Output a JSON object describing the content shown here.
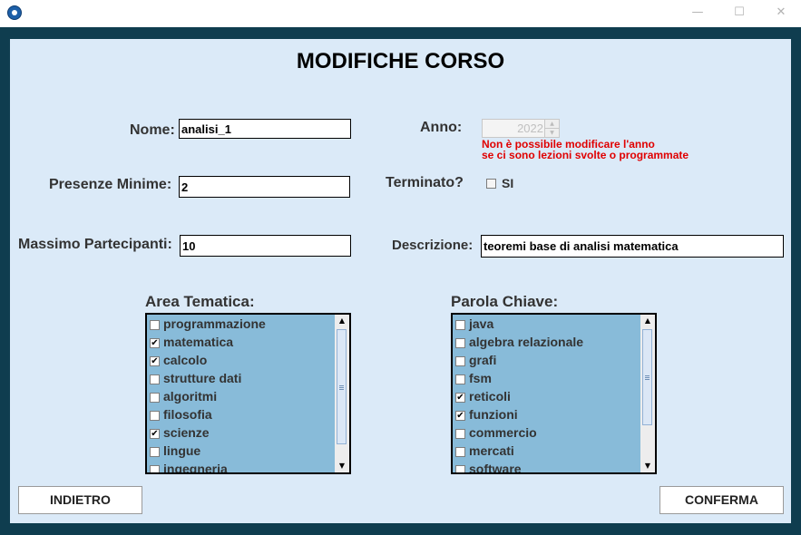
{
  "window": {
    "minimize_glyph": "—",
    "maximize_glyph": "☐",
    "close_glyph": "✕"
  },
  "heading": "MODIFICHE CORSO",
  "form": {
    "nome_label": "Nome:",
    "nome_value": "analisi_1",
    "presenze_label": "Presenze Minime:",
    "presenze_value": "2",
    "massimo_label": "Massimo Partecipanti:",
    "massimo_value": "10",
    "anno_label": "Anno:",
    "anno_value": "2022",
    "anno_warning_line1": "Non è possibile modificare l'anno",
    "anno_warning_line2": "se ci sono lezioni svolte o programmate",
    "terminato_label": "Terminato?",
    "terminato_option": "SI",
    "terminato_checked": false,
    "descrizione_label": "Descrizione:",
    "descrizione_value": "teoremi base di analisi matematica"
  },
  "area_tematica": {
    "title": "Area Tematica:",
    "items": [
      {
        "label": "programmazione",
        "checked": false
      },
      {
        "label": "matematica",
        "checked": true
      },
      {
        "label": "calcolo",
        "checked": true
      },
      {
        "label": "strutture dati",
        "checked": false
      },
      {
        "label": "algoritmi",
        "checked": false
      },
      {
        "label": "filosofia",
        "checked": false
      },
      {
        "label": "scienze",
        "checked": true
      },
      {
        "label": "lingue",
        "checked": false
      },
      {
        "label": "ingegneria",
        "checked": false
      }
    ]
  },
  "parola_chiave": {
    "title": "Parola Chiave:",
    "items": [
      {
        "label": "java",
        "checked": false
      },
      {
        "label": "algebra relazionale",
        "checked": false
      },
      {
        "label": "grafi",
        "checked": false
      },
      {
        "label": "fsm",
        "checked": false
      },
      {
        "label": "reticoli",
        "checked": true
      },
      {
        "label": "funzioni",
        "checked": true
      },
      {
        "label": "commercio",
        "checked": false
      },
      {
        "label": "mercati",
        "checked": false
      },
      {
        "label": "software",
        "checked": false
      }
    ]
  },
  "buttons": {
    "back": "INDIETRO",
    "confirm": "CONFERMA"
  },
  "colors": {
    "list_bg": "#88bbd9",
    "panel_bg": "#dbeaf8",
    "frame": "#0f3d4f",
    "warning": "#e00000"
  },
  "icons": {
    "check": "✔",
    "scroll_up": "▲",
    "scroll_down": "▼"
  }
}
